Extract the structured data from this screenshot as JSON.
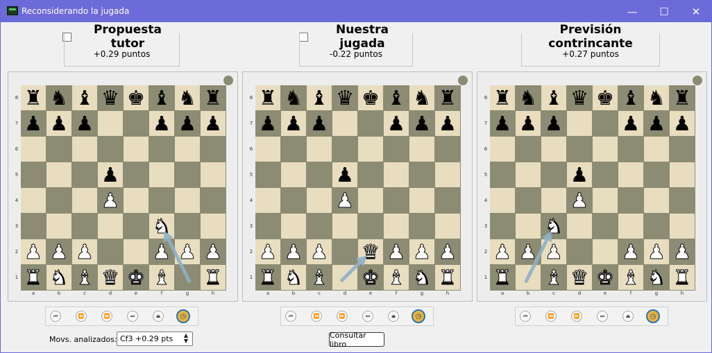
{
  "window": {
    "title": "Reconsiderando la jugada",
    "minimize_icon": "minimize-icon",
    "maximize_icon": "maximize-icon",
    "close_icon": "close-icon"
  },
  "columns": [
    {
      "id": "tutor",
      "title": "Propuesta tutor",
      "has_checkbox": true,
      "checked": false,
      "score": "+0.29 puntos",
      "board": [
        [
          "r",
          "n",
          "b",
          "q",
          "k",
          "b",
          "n",
          "r"
        ],
        [
          "p",
          "p",
          "p",
          "",
          "",
          "p",
          "p",
          "p"
        ],
        [
          "",
          "",
          "",
          "",
          "",
          "",
          "",
          ""
        ],
        [
          "",
          "",
          "",
          "p",
          "",
          "",
          "",
          ""
        ],
        [
          "",
          "",
          "",
          "P",
          "",
          "",
          "",
          ""
        ],
        [
          "",
          "",
          "",
          "",
          "",
          "N",
          "",
          ""
        ],
        [
          "P",
          "P",
          "P",
          "",
          "",
          "P",
          "P",
          "P"
        ],
        [
          "R",
          "N",
          "B",
          "Q",
          "K",
          "B",
          "",
          "R"
        ]
      ],
      "arrow": {
        "from": "g1",
        "to": "f3"
      }
    },
    {
      "id": "nuestra",
      "title": "Nuestra jugada",
      "has_checkbox": true,
      "checked": false,
      "score": "-0.22 puntos",
      "board": [
        [
          "r",
          "n",
          "b",
          "q",
          "k",
          "b",
          "n",
          "r"
        ],
        [
          "p",
          "p",
          "p",
          "",
          "",
          "p",
          "p",
          "p"
        ],
        [
          "",
          "",
          "",
          "",
          "",
          "",
          "",
          ""
        ],
        [
          "",
          "",
          "",
          "p",
          "",
          "",
          "",
          ""
        ],
        [
          "",
          "",
          "",
          "P",
          "",
          "",
          "",
          ""
        ],
        [
          "",
          "",
          "",
          "",
          "",
          "",
          "",
          ""
        ],
        [
          "P",
          "P",
          "P",
          "",
          "Q",
          "P",
          "P",
          "P"
        ],
        [
          "R",
          "N",
          "B",
          "",
          "K",
          "B",
          "N",
          "R"
        ]
      ],
      "arrow": {
        "from": "d1",
        "to": "e2"
      }
    },
    {
      "id": "prevision",
      "title": "Previsión contrincante",
      "has_checkbox": false,
      "checked": false,
      "score": "+0.27 puntos",
      "board": [
        [
          "r",
          "n",
          "b",
          "q",
          "k",
          "b",
          "n",
          "r"
        ],
        [
          "p",
          "p",
          "p",
          "",
          "",
          "p",
          "p",
          "p"
        ],
        [
          "",
          "",
          "",
          "",
          "",
          "",
          "",
          ""
        ],
        [
          "",
          "",
          "",
          "p",
          "",
          "",
          "",
          ""
        ],
        [
          "",
          "",
          "",
          "P",
          "",
          "",
          "",
          ""
        ],
        [
          "",
          "",
          "N",
          "",
          "",
          "",
          "",
          ""
        ],
        [
          "P",
          "P",
          "P",
          "",
          "",
          "P",
          "P",
          "P"
        ],
        [
          "R",
          "",
          "B",
          "Q",
          "K",
          "B",
          "N",
          "R"
        ]
      ],
      "arrow": {
        "from": "b1",
        "to": "c3"
      }
    }
  ],
  "ranks": [
    "8",
    "7",
    "6",
    "5",
    "4",
    "3",
    "2",
    "1"
  ],
  "files": [
    "a",
    "b",
    "c",
    "d",
    "e",
    "f",
    "g",
    "h"
  ],
  "nav_buttons": [
    "first-icon",
    "back-icon",
    "forward-icon",
    "last-icon",
    "eject-icon",
    "clock-icon"
  ],
  "colors": {
    "titlebar": "#6d6ad9",
    "light_square": "#e8ddbf",
    "dark_square": "#8c8b73",
    "arrow": "#8fb0c8"
  },
  "footer": {
    "movs_label": "Movs. analizados:",
    "movs_value": "Cf3 +0.29 pts",
    "book_button": "Consultar libro"
  }
}
